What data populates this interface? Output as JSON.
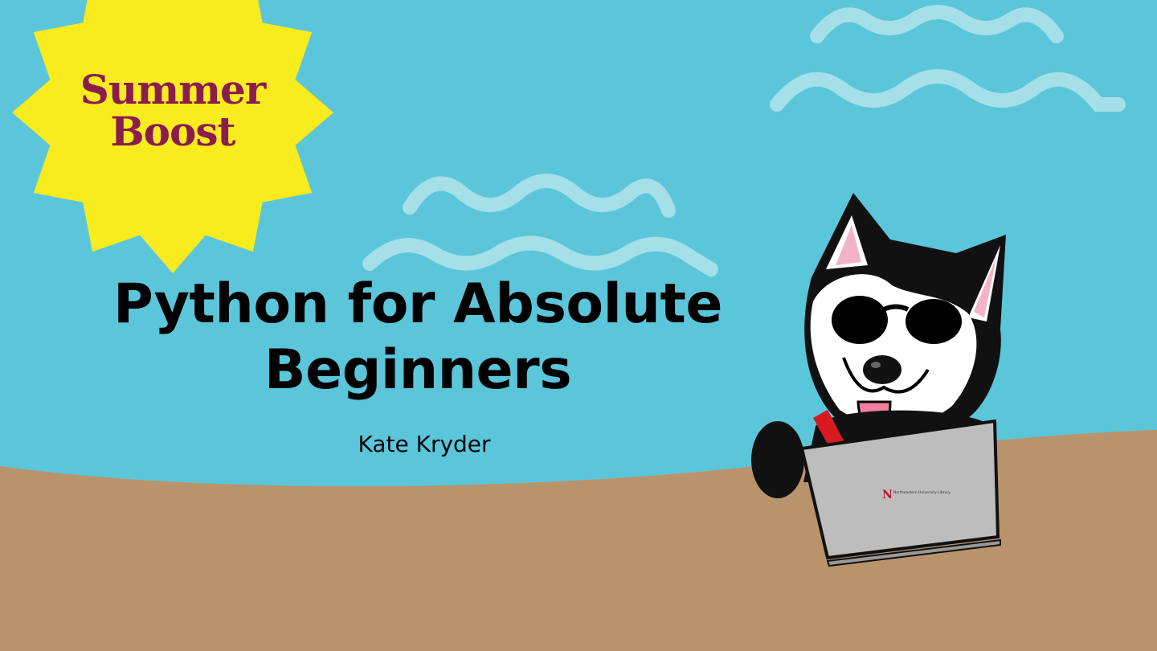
{
  "slide": {
    "badge_line1": "Summer",
    "badge_line2": "Boost",
    "title_line1": "Python for Absolute",
    "title_line2": "Beginners",
    "author": "Kate Kryder",
    "laptop_logo": "Northeastern University Library"
  },
  "colors": {
    "sky": "#5bc6da",
    "sand": "#b9936c",
    "sun": "#f8eb1e",
    "badge_text": "#8b1c4e",
    "waves": "#a5dfe8",
    "text": "#000000"
  },
  "icons": [
    "sun-icon",
    "husky-mascot-icon",
    "laptop-icon",
    "wave-icon"
  ]
}
